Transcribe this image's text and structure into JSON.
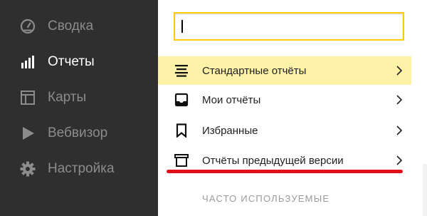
{
  "sidebar": {
    "items": [
      {
        "label": "Сводка",
        "icon": "gauge-icon",
        "active": false
      },
      {
        "label": "Отчеты",
        "icon": "bar-chart-icon",
        "active": true
      },
      {
        "label": "Карты",
        "icon": "map-layout-icon",
        "active": false
      },
      {
        "label": "Вебвизор",
        "icon": "play-icon",
        "active": false
      },
      {
        "label": "Настройка",
        "icon": "gear-icon",
        "active": false
      }
    ]
  },
  "search": {
    "value": "",
    "placeholder": ""
  },
  "menu": {
    "items": [
      {
        "label": "Стандартные отчёты",
        "icon": "list-icon",
        "highlighted": true
      },
      {
        "label": "Мои отчёты",
        "icon": "tray-icon",
        "highlighted": false
      },
      {
        "label": "Избранные",
        "icon": "bookmark-icon",
        "highlighted": false
      },
      {
        "label": "Отчёты предыдущей версии",
        "icon": "archive-icon",
        "highlighted": false
      }
    ]
  },
  "section": {
    "title": "ЧАСТО ИСПОЛЬЗУЕМЫЕ"
  },
  "colors": {
    "sidebar_bg": "#2f2f2f",
    "highlight": "#fdf2a8",
    "search_border": "#ffcc00",
    "annotation_underline": "#e0101a"
  }
}
